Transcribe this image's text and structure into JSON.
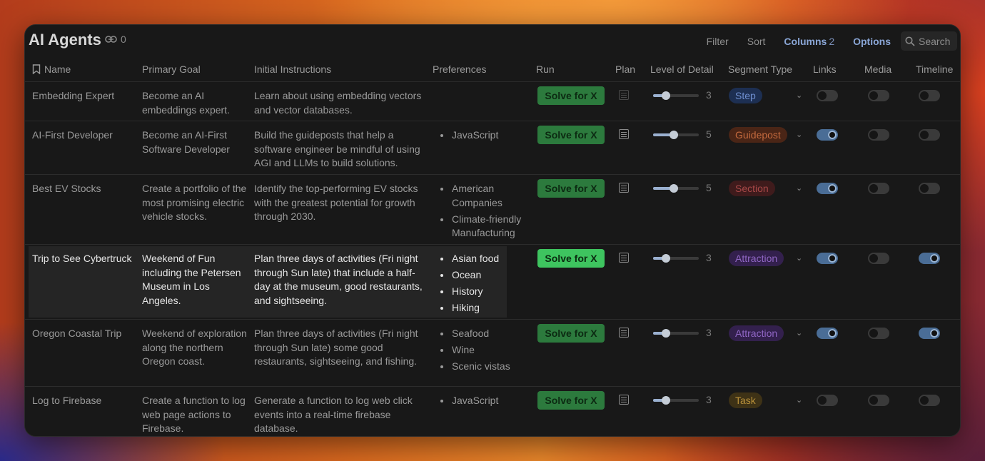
{
  "title": "AI Agents",
  "link_count": "0",
  "toolbar": {
    "filter": "Filter",
    "sort": "Sort",
    "columns": "Columns",
    "columns_count": "2",
    "options": "Options",
    "search": "Search"
  },
  "columns": {
    "name": "Name",
    "goal": "Primary Goal",
    "instructions": "Initial Instructions",
    "preferences": "Preferences",
    "run": "Run",
    "plan": "Plan",
    "detail": "Level of Detail",
    "segment": "Segment Type",
    "links": "Links",
    "media": "Media",
    "timeline": "Timeline"
  },
  "colors": {
    "step": "#5b7fd0",
    "guidepost": "#d86a3a",
    "section": "#c24a4a",
    "attraction": "#8e5cc8",
    "task": "#c79a2e",
    "run_button": "#2c7a3d"
  },
  "rows": [
    {
      "name": "Embedding Expert",
      "goal": "Become an AI embeddings expert.",
      "instructions": "Learn about using embedding vectors and vector databases.",
      "preferences": [],
      "run": "Solve for X",
      "level": "3",
      "level_fraction": 0.28,
      "segment": "Step",
      "links": false,
      "media": false,
      "timeline": false
    },
    {
      "name": "AI-First Developer",
      "goal": "Become an AI-First Software Developer",
      "instructions": "Build the guideposts that help a software engineer be mindful of using AGI and LLMs to build solutions.",
      "preferences": [
        "JavaScript"
      ],
      "run": "Solve for X",
      "level": "5",
      "level_fraction": 0.46,
      "segment": "Guidepost",
      "links": true,
      "media": false,
      "timeline": false
    },
    {
      "name": "Best EV Stocks",
      "goal": "Create a portfolio of the most promising electric vehicle stocks.",
      "instructions": "Identify the top-performing EV stocks with the greatest potential for growth through 2030.",
      "preferences": [
        "American Companies",
        "Climate-friendly Manufacturing"
      ],
      "run": "Solve for X",
      "level": "5",
      "level_fraction": 0.46,
      "segment": "Section",
      "links": true,
      "media": false,
      "timeline": false
    },
    {
      "name": "Trip to See Cybertruck",
      "goal": "Weekend of Fun including the Petersen Museum in Los Angeles.",
      "instructions": "Plan three days of activities (Fri night through Sun late) that include a half-day at the museum, good restaurants, and sightseeing.",
      "preferences": [
        "Asian food",
        "Ocean",
        "History",
        "Hiking"
      ],
      "run": "Solve for X",
      "level": "3",
      "level_fraction": 0.28,
      "segment": "Attraction",
      "links": true,
      "media": false,
      "timeline": true
    },
    {
      "name": "Oregon Coastal Trip",
      "goal": "Weekend of exploration along the northern Oregon coast.",
      "instructions": "Plan three days of activities (Fri night through Sun late) some good restaurants, sightseeing, and fishing.",
      "preferences": [
        "Seafood",
        "Wine",
        "Scenic vistas"
      ],
      "run": "Solve for X",
      "level": "3",
      "level_fraction": 0.28,
      "segment": "Attraction",
      "links": true,
      "media": false,
      "timeline": true
    },
    {
      "name": "Log to Firebase",
      "goal": "Create a function to log web page actions to Firebase.",
      "instructions": "Generate a function to log web click events into a real-time firebase database.",
      "preferences": [
        "JavaScript"
      ],
      "run": "Solve for X",
      "level": "3",
      "level_fraction": 0.28,
      "segment": "Task",
      "links": false,
      "media": false,
      "timeline": false
    }
  ]
}
